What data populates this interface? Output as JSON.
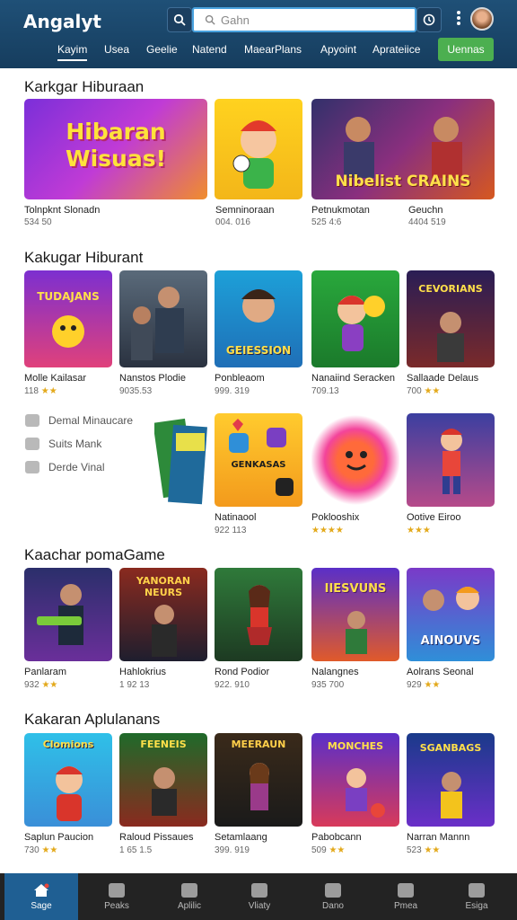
{
  "header": {
    "logo": "Angalyt",
    "search_placeholder": "Gahn",
    "nav": [
      "Kayim",
      "Usea",
      "Geelie",
      "Natend",
      "MaearPlans",
      "Apyoint",
      "Aprateiice"
    ],
    "nav_button": "Uennas"
  },
  "sections": [
    {
      "title": "Karkgar Hiburaan"
    },
    {
      "title": "Kakugar Hiburant"
    },
    {
      "title": "Kaachar pomaGame"
    },
    {
      "title": "Kakaran Aplulanans"
    }
  ],
  "row1": [
    {
      "label": "Tolnpknt Slonadn",
      "sub": "534 50",
      "art": "Hibaran Wisuas!"
    },
    {
      "label": "Semninoraan",
      "sub": "004. 016",
      "art": ""
    },
    {
      "label": "Petnukmotan",
      "sub": "525 4:6",
      "art": "Nibelist CRAINS"
    },
    {
      "label": "Geuchn",
      "sub": "4404 519",
      "art": ""
    }
  ],
  "row2": [
    {
      "label": "Molle Kailasar",
      "sub": "118",
      "stars": "★★",
      "art": "TUDAJANS"
    },
    {
      "label": "Nanstos Plodie",
      "sub": "9035.53",
      "stars": "",
      "art": ""
    },
    {
      "label": "Ponbleaom",
      "sub": "999. 319",
      "stars": "",
      "art": "GEIESSION"
    },
    {
      "label": "Nanaiind Seracken",
      "sub": "709.13",
      "stars": "",
      "art": ""
    },
    {
      "label": "Sallaade Delaus",
      "sub": "700",
      "stars": "★★",
      "art": "CEVORIANS"
    }
  ],
  "side_menu": [
    "Demal Minaucare",
    "Suits Mank",
    "Derde Vinal"
  ],
  "row3": [
    {
      "label": "Natinaool",
      "sub": "922 113",
      "stars": ""
    },
    {
      "label": "Poklooshix",
      "sub": "",
      "stars": "★★★★"
    },
    {
      "label": "Ootive Eiroo",
      "sub": "",
      "stars": "★★★"
    }
  ],
  "row3_art": "GENKASAS",
  "row4": [
    {
      "label": "Panlaram",
      "sub": "932",
      "stars": "★★",
      "art": ""
    },
    {
      "label": "Hahlokrius",
      "sub": "1 92 13",
      "stars": "",
      "art": "YANORAN NEURS"
    },
    {
      "label": "Rond Podior",
      "sub": "922. 910",
      "stars": "",
      "art": ""
    },
    {
      "label": "Nalangnes",
      "sub": "935 700",
      "stars": "",
      "art": "IIESVUNS"
    },
    {
      "label": "Aolrans Seonal",
      "sub": "929",
      "stars": "★★",
      "art": "AINOUVS"
    }
  ],
  "row5": [
    {
      "label": "Saplun Paucion",
      "sub": "730",
      "stars": "★★",
      "art": "Clomions"
    },
    {
      "label": "Raloud Pissaues",
      "sub": "1 65 1.5",
      "stars": "",
      "art": "FEENEIS"
    },
    {
      "label": "Setamlaang",
      "sub": "399. 919",
      "stars": "",
      "art": "MEERAUN"
    },
    {
      "label": "Pabobcann",
      "sub": "509",
      "stars": "★★",
      "art": "MONCHES"
    },
    {
      "label": "Narran Mannn",
      "sub": "523",
      "stars": "★★",
      "art": "SGANBAGS"
    }
  ],
  "tabs": [
    "Sage",
    "Peaks",
    "Aplilic",
    "Vliaty",
    "Dano",
    "Pmea",
    "Esiga"
  ]
}
